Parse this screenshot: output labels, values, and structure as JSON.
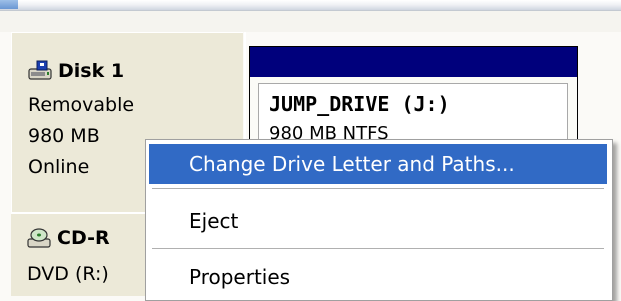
{
  "disk1": {
    "title": "Disk 1",
    "type": "Removable",
    "size": "980 MB",
    "status": "Online"
  },
  "volume": {
    "name": "JUMP_DRIVE  (J:)",
    "info": "980 MB NTFS"
  },
  "cdrom": {
    "title": "CD-R",
    "drive": "DVD (R:)"
  },
  "context_menu": {
    "items": [
      "Change Drive Letter and Paths...",
      "Eject",
      "Properties"
    ],
    "selected_index": 0
  },
  "colors": {
    "selection": "#316ac5",
    "volume_header": "#00007c",
    "panel": "#ece9d8"
  }
}
